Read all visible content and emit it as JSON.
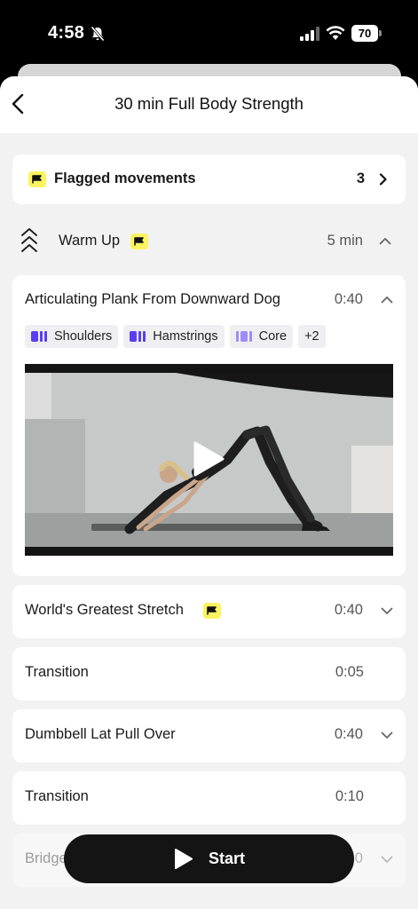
{
  "status_bar": {
    "time": "4:58",
    "battery": "70"
  },
  "header": {
    "title": "30 min Full Body Strength"
  },
  "flagged": {
    "label": "Flagged movements",
    "count": "3"
  },
  "section": {
    "title": "Warm Up",
    "duration": "5 min"
  },
  "expanded_exercise": {
    "name": "Articulating Plank From Downward Dog",
    "duration": "0:40",
    "tags": [
      {
        "label": "Shoulders",
        "color": "#5b3df5"
      },
      {
        "label": "Hamstrings",
        "color": "#5b3df5"
      },
      {
        "label": "Core",
        "color": "#a08cf7"
      }
    ],
    "more_tags": "+2"
  },
  "exercises": [
    {
      "name": "World's Greatest Stretch",
      "duration": "0:40"
    },
    {
      "name": "Transition",
      "duration": "0:05"
    },
    {
      "name": "Dumbbell Lat Pull Over",
      "duration": "0:40"
    },
    {
      "name": "Transition",
      "duration": "0:10"
    },
    {
      "name": "Bridge",
      "duration": "0:40"
    }
  ],
  "start_button": {
    "label": "Start"
  },
  "colors": {
    "flag_badge": "#fbf35f",
    "tag_primary": "#5b3df5",
    "tag_secondary": "#a08cf7",
    "background": "#f2f2f3"
  },
  "icons": [
    "back-chevron-icon",
    "flag-icon",
    "chevron-right-icon",
    "chevron-up-icon",
    "chevron-down-icon",
    "warm-up-chevrons-icon",
    "play-icon",
    "muscle-bar-icon"
  ]
}
